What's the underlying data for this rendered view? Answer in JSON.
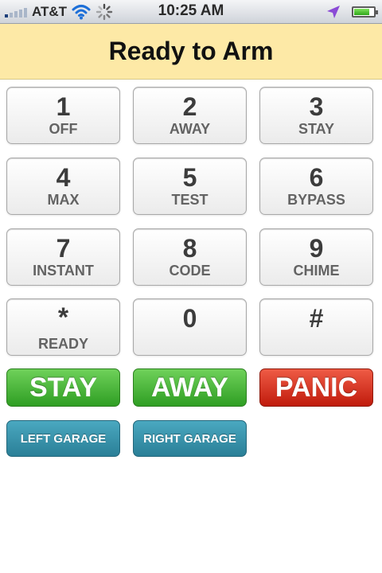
{
  "status_bar": {
    "carrier": "AT&T",
    "time": "10:25 AM",
    "signal_bars": 5,
    "signal_bars_filled": 1,
    "battery_level": 0.75,
    "icons": [
      "signal-icon",
      "wifi-icon",
      "activity-spinner-icon",
      "location-arrow-icon",
      "battery-icon"
    ]
  },
  "header": {
    "title": "Ready to Arm",
    "background": "#fde9a6"
  },
  "keypad": [
    {
      "num": "1",
      "label": "OFF"
    },
    {
      "num": "2",
      "label": "AWAY"
    },
    {
      "num": "3",
      "label": "STAY"
    },
    {
      "num": "4",
      "label": "MAX"
    },
    {
      "num": "5",
      "label": "TEST"
    },
    {
      "num": "6",
      "label": "BYPASS"
    },
    {
      "num": "7",
      "label": "INSTANT"
    },
    {
      "num": "8",
      "label": "CODE"
    },
    {
      "num": "9",
      "label": "CHIME"
    },
    {
      "num": "*",
      "label": "READY"
    },
    {
      "num": "0",
      "label": ""
    },
    {
      "num": "#",
      "label": ""
    }
  ],
  "actions": {
    "stay": "STAY",
    "away": "AWAY",
    "panic": "PANIC",
    "colors": {
      "green": "#3fb02e",
      "red": "#d9321d"
    }
  },
  "garage": {
    "left": "LEFT GARAGE",
    "right": "RIGHT GARAGE",
    "color": "#3994ad"
  }
}
